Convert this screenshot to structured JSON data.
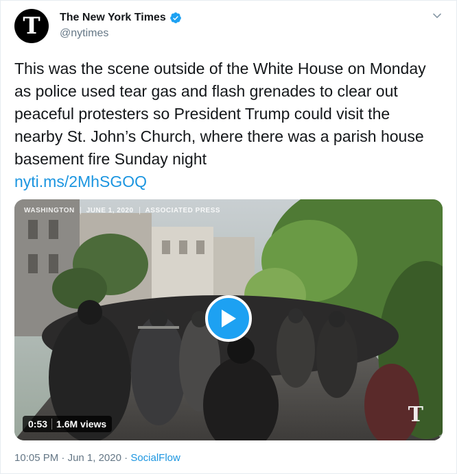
{
  "author": {
    "display_name": "The New York Times",
    "handle": "@nytimes",
    "avatar_glyph": "T",
    "verified_icon": "verified-badge-icon"
  },
  "tweet": {
    "text": "This was the scene outside of the White House on Monday as police used tear gas and flash grenades to clear out peaceful protesters so President Trump could visit the nearby St. John’s Church, where there was a parish house basement fire Sunday night",
    "link": "nyti.ms/2MhSGOQ"
  },
  "video": {
    "watermark": [
      "WASHINGTON",
      "JUNE 1, 2020",
      "ASSOCIATED PRESS"
    ],
    "duration": "0:53",
    "views": "1.6M views",
    "corner_logo": "T"
  },
  "footer": {
    "time": "10:05 PM",
    "separator": "·",
    "date": "Jun 1, 2020",
    "source": "SocialFlow"
  },
  "colors": {
    "link": "#1b95e0",
    "play_button": "#1da1f2",
    "muted_text": "#657786"
  }
}
